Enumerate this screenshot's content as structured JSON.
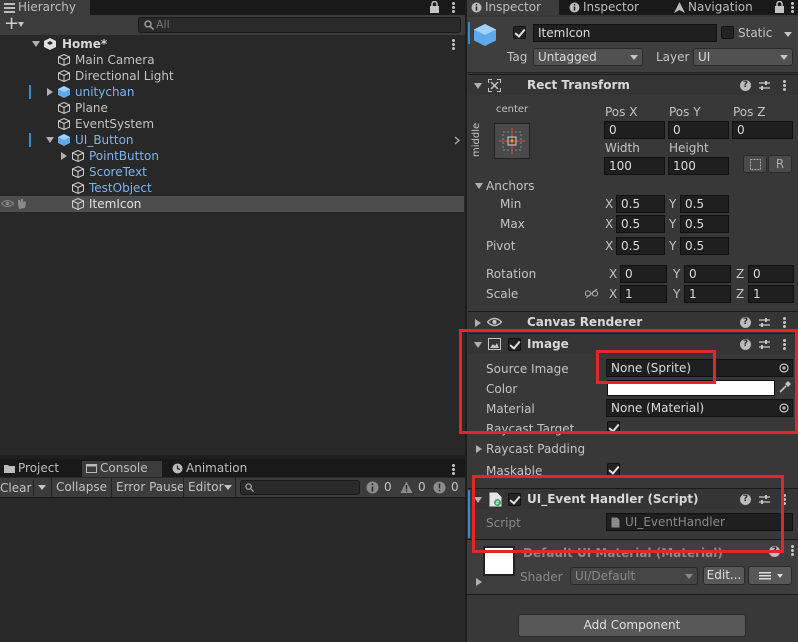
{
  "hierarchy": {
    "tab_label": "Hierarchy",
    "search_placeholder": "All",
    "scene_name": "Home*",
    "items": [
      {
        "label": "Main Camera"
      },
      {
        "label": "Directional Light"
      },
      {
        "label": "unitychan"
      },
      {
        "label": "Plane"
      },
      {
        "label": "EventSystem"
      },
      {
        "label": "UI_Button"
      },
      {
        "label": "PointButton"
      },
      {
        "label": "ScoreText"
      },
      {
        "label": "TestObject"
      },
      {
        "label": "ItemIcon"
      }
    ]
  },
  "bottom_panel": {
    "tabs": [
      {
        "label": "Project"
      },
      {
        "label": "Console"
      },
      {
        "label": "Animation"
      }
    ],
    "console_toolbar": {
      "clear": "Clear",
      "collapse": "Collapse",
      "error_pause": "Error Pause",
      "editor": "Editor",
      "count_info": "0",
      "count_warn": "0",
      "count_error": "0"
    }
  },
  "inspector": {
    "tabs": [
      {
        "label": "Inspector"
      },
      {
        "label": "Inspector"
      },
      {
        "label": "Navigation"
      }
    ],
    "object_name": "ItemIcon",
    "static_label": "Static",
    "tag_label": "Tag",
    "tag_value": "Untagged",
    "layer_label": "Layer",
    "layer_value": "UI",
    "rect_transform": {
      "title": "Rect Transform",
      "anchor_preset": "center",
      "anchor_preset_side": "middle",
      "pos_x_label": "Pos X",
      "pos_y_label": "Pos Y",
      "pos_z_label": "Pos Z",
      "pos_x": "0",
      "pos_y": "0",
      "pos_z": "0",
      "width_label": "Width",
      "height_label": "Height",
      "width": "100",
      "height": "100",
      "r_button": "R",
      "anchors_label": "Anchors",
      "min_label": "Min",
      "max_label": "Max",
      "pivot_label": "Pivot",
      "x_label": "X",
      "y_label": "Y",
      "z_label": "Z",
      "min_x": "0.5",
      "min_y": "0.5",
      "max_x": "0.5",
      "max_y": "0.5",
      "pivot_x": "0.5",
      "pivot_y": "0.5",
      "rotation_label": "Rotation",
      "scale_label": "Scale",
      "rot_x": "0",
      "rot_y": "0",
      "rot_z": "0",
      "scale_x": "1",
      "scale_y": "1",
      "scale_z": "1"
    },
    "canvas_renderer": {
      "title": "Canvas Renderer"
    },
    "image": {
      "title": "Image",
      "source_image_label": "Source Image",
      "source_image_value": "None (Sprite)",
      "color_label": "Color",
      "material_label": "Material",
      "material_value": "None (Material)",
      "raycast_target_label": "Raycast Target",
      "raycast_padding_label": "Raycast Padding",
      "maskable_label": "Maskable"
    },
    "event_handler": {
      "title": "UI_Event Handler (Script)",
      "script_label": "Script",
      "script_value": "UI_EventHandler"
    },
    "material_preview": {
      "title": "Default UI Material (Material)",
      "shader_label": "Shader",
      "shader_value": "UI/Default",
      "edit_button": "Edit..."
    },
    "add_component": "Add Component"
  },
  "colors": {
    "highlight_red": "#e3262a",
    "prefab_blue": "#7db4f0",
    "selection": "#4d4d4d"
  }
}
